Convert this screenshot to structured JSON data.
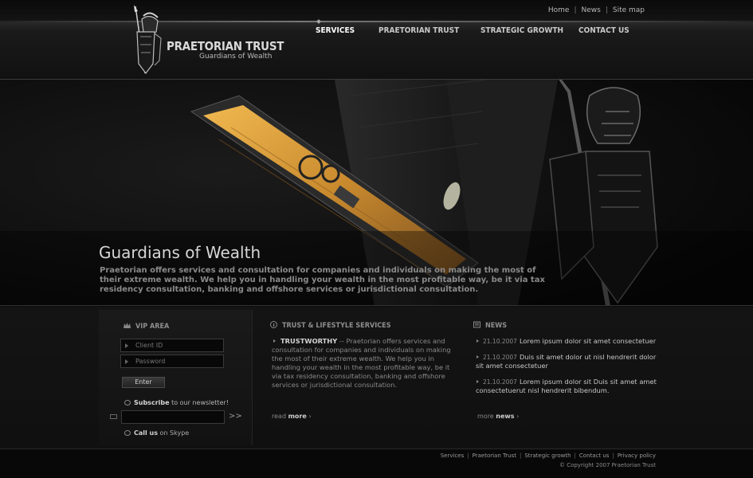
{
  "brand": {
    "name": "PRAETORIAN TRUST",
    "tagline": "Guardians of Wealth"
  },
  "toplinks": [
    "Home",
    "News",
    "Site map"
  ],
  "nav": [
    {
      "label": "SERVICES",
      "active": true
    },
    {
      "label": "PRAETORIAN TRUST",
      "active": false
    },
    {
      "label": "STRATEGIC GROWTH",
      "active": false
    },
    {
      "label": "CONTACT US",
      "active": false
    }
  ],
  "hero": {
    "title": "Guardians of Wealth",
    "text": "Praetorian offers services and consultation for companies and individuals on making the most of their extreme wealth.  We help you in handling your wealth in the most profitable way, be it via tax residency consultation, banking and offshore services or jurisdictional consultation."
  },
  "vip": {
    "heading": "VIP AREA",
    "client_id_placeholder": "Client ID",
    "password_placeholder": "Password",
    "enter_label": "Enter",
    "subscribe_bold": "Subscribe",
    "subscribe_rest": " to our newsletter!",
    "go_label": ">>",
    "skype_bold": "Call us",
    "skype_rest": " on Skype"
  },
  "trust": {
    "heading": "TRUST & LIFESTYLE SERVICES",
    "title": "TRUSTWORTHY",
    "body": " -- Praetorian offers services and consultation for companies and individuals on making the most of their extreme wealth.  We help you in handling your wealth in the most profitable way, be it via tax residency consultation, banking and offshore services or jurisdictional consultation.",
    "read_label": "read ",
    "more_label": "more"
  },
  "news": {
    "heading": "NEWS",
    "items": [
      {
        "date": "21.10.2007",
        "text": "Lorem ipsum dolor sit amet consectetuer"
      },
      {
        "date": "21.10.2007",
        "text": "Duis sit amet dolor ut nisl hendrerit dolor sit amet consectetuer"
      },
      {
        "date": "21.10.2007",
        "text": "Lorem ipsum dolor sit Duis sit amet amet consectetuerut nisl hendrerit bibendum."
      }
    ],
    "more_label": "more ",
    "news_label": "news"
  },
  "footer": {
    "links": [
      "Services",
      "Praetorian Trust",
      "Strategic growth",
      "Contact us",
      "Privacy policy"
    ],
    "copyright": "© Copyright  2007  Praetorian Trust"
  },
  "colors": {
    "background": "#0b0b0b",
    "accent_wood": "#d79a3a",
    "text_light": "#d6d6d6",
    "text_dim": "#8a8a8a"
  }
}
